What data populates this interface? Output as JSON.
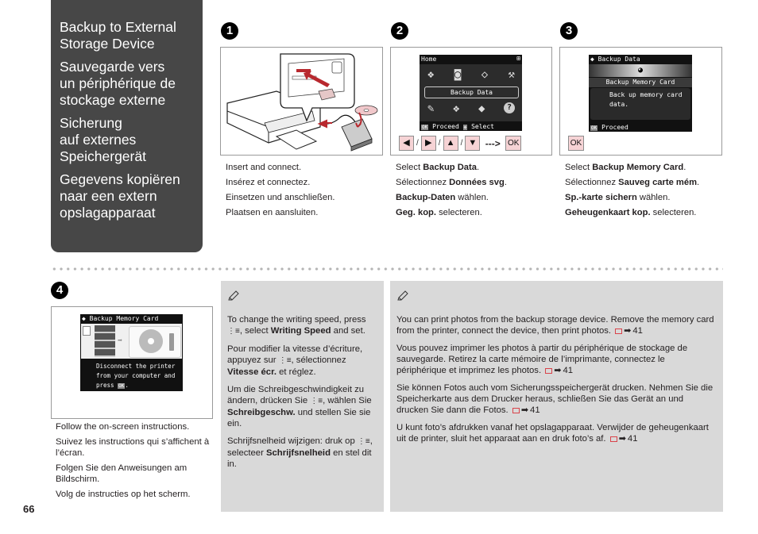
{
  "titles": [
    "Backup to External\nStorage Device",
    "Sauvegarde vers\nun périphérique de\nstockage externe",
    "Sicherung\nauf externes\nSpeichergerät",
    "Gegevens kopiëren\nnaar een extern\nopslagapparaat"
  ],
  "steps": [
    {
      "number": "1",
      "captions": [
        {
          "pre": "Insert and connect.",
          "bold": "",
          "post": ""
        },
        {
          "pre": "Insérez et connectez.",
          "bold": "",
          "post": ""
        },
        {
          "pre": "Einsetzen und anschließen.",
          "bold": "",
          "post": ""
        },
        {
          "pre": "Plaatsen en aansluiten.",
          "bold": "",
          "post": ""
        }
      ]
    },
    {
      "number": "2",
      "screen": {
        "header": "Home",
        "selected": "Backup Data",
        "footer_ok": "OK",
        "footer_proceed": "Proceed",
        "footer_select": "Select"
      },
      "keys": [
        "◀",
        "▶",
        "▲",
        "▼"
      ],
      "key_sep": "/",
      "arrow": "--->",
      "ok": "OK",
      "captions": [
        {
          "pre": "Select ",
          "bold": "Backup Data",
          "post": "."
        },
        {
          "pre": "Sélectionnez ",
          "bold": "Données svg",
          "post": "."
        },
        {
          "pre": "",
          "bold": "Backup-Daten",
          "post": " wählen."
        },
        {
          "pre": "",
          "bold": "Geg. kop.",
          "post": " selecteren."
        }
      ]
    },
    {
      "number": "3",
      "screen": {
        "header": "Backup Data",
        "item": "Backup Memory Card",
        "desc": "Back up memory card\ndata.",
        "footer_ok": "OK",
        "footer_proceed": "Proceed"
      },
      "ok": "OK",
      "captions": [
        {
          "pre": "Select ",
          "bold": "Backup Memory Card",
          "post": "."
        },
        {
          "pre": "Sélectionnez ",
          "bold": "Sauveg carte mém",
          "post": "."
        },
        {
          "pre": "",
          "bold": "Sp.-karte sichern",
          "post": " wählen."
        },
        {
          "pre": "",
          "bold": "Geheugenkaart kop.",
          "post": " selecteren."
        }
      ]
    },
    {
      "number": "4",
      "screen": {
        "header": "Backup Memory Card",
        "msg1": "Disconnect the printer",
        "msg2": "from your computer and",
        "msg3_pre": "press",
        "msg3_ok": "OK",
        "msg3_post": "."
      },
      "captions": [
        "Follow the on-screen instructions.",
        "Suivez les instructions qui s’affichent à l’écran.",
        "Folgen Sie den Anweisungen am Bildschirm.",
        "Volg de instructies op het scherm."
      ]
    }
  ],
  "note1": [
    {
      "a": "To change the writing speed, press ",
      "icon": "⋮≡",
      "b": ", select ",
      "bold": "Writing Speed",
      "c": " and set."
    },
    {
      "a": "Pour modifier la vitesse d’écriture, appuyez sur ",
      "icon": "⋮≡",
      "b": ", sélectionnez ",
      "bold": "Vitesse écr.",
      "c": " et réglez."
    },
    {
      "a": "Um die Schreibgeschwindigkeit zu ändern, drücken Sie ",
      "icon": "⋮≡",
      "b": ", wählen Sie ",
      "bold": "Schreibgeschw.",
      "c": " und stellen Sie sie ein."
    },
    {
      "a": "Schrijfsnelheid wijzigen: druk op ",
      "icon": "⋮≡",
      "b": ", selecteer ",
      "bold": "Schrijfsnelheid",
      "c": " en stel dit in."
    }
  ],
  "note2": [
    {
      "text": "You can print photos from the backup storage device. Remove the memory card from the printer, connect the device, then print photos.",
      "ref": "41"
    },
    {
      "text": "Vous pouvez imprimer les photos à partir du périphérique de stockage de sauvegarde. Retirez la carte mémoire de l’imprimante, connectez le périphérique et imprimez les photos.",
      "ref": "41"
    },
    {
      "text": "Sie können Fotos auch vom Sicherungsspeichergerät drucken. Nehmen Sie die Speicherkarte aus dem Drucker heraus, schließen Sie das Gerät an und drucken Sie dann die Fotos.",
      "ref": "41"
    },
    {
      "text": "U kunt foto’s afdrukken vanaf het opslagapparaat. Verwijder de geheugenkaart uit de printer, sluit het apparaat aan en druk foto’s af.",
      "ref": "41"
    }
  ],
  "ref_arrow": "➡",
  "page_number": "66",
  "colors": {
    "title_panel": "#474747",
    "note_bg": "#d9d9d9",
    "key_bg": "#f6d3d5",
    "ref_icon": "#d9434a"
  }
}
